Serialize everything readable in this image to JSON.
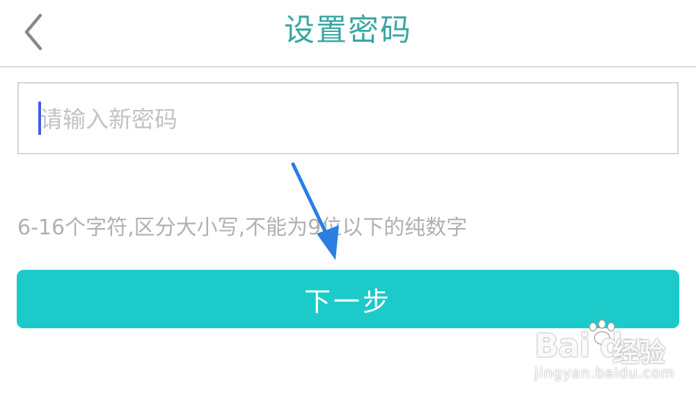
{
  "header": {
    "title": "设置密码",
    "back_icon": "chevron-left-icon"
  },
  "password_form": {
    "new_password": {
      "value": "",
      "placeholder": "请输入新密码"
    },
    "hint": "6-16个字符,区分大小写,不能为9位以下的纯数字",
    "next_label": "下一步"
  },
  "watermark": {
    "logo_text": "Bai du",
    "brand_text": "经验",
    "url_text": "jingyan.baidu.com"
  },
  "colors": {
    "title": "#3aa6a3",
    "primary_button": "#1ccbc9",
    "caret": "#3f5de8",
    "annotation_arrow": "#2a7fe0"
  }
}
